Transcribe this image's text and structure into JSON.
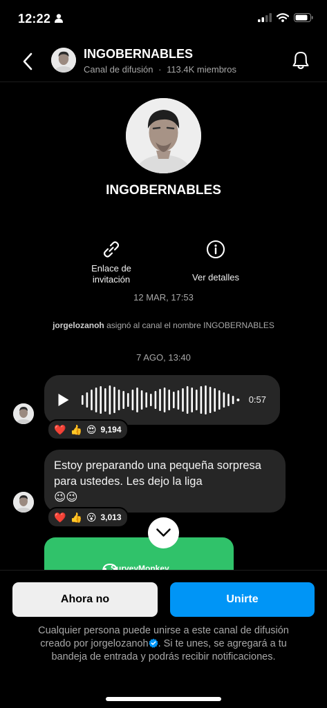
{
  "status": {
    "time": "12:22"
  },
  "header": {
    "title": "INGOBERNABLES",
    "subtitle_kind": "Canal de difusión",
    "separator": "·",
    "members": "113.4K miembros"
  },
  "profile": {
    "name": "INGOBERNABLES"
  },
  "actions": {
    "invite_line1": "Enlace de",
    "invite_line2": "invitación",
    "details": "Ver detalles"
  },
  "timeline": {
    "date1": "12 MAR, 17:53",
    "system_user": "jorgelozanoh",
    "system_text": " asignó al canal el nombre INGOBERNABLES",
    "date2": "7 AGO, 13:40"
  },
  "voice_message": {
    "duration": "0:57",
    "reactions": {
      "emojis": [
        "❤️",
        "👍",
        "😍"
      ],
      "count": "9,194"
    }
  },
  "text_message": {
    "text": "Estoy preparando una pequeña sorpresa para ustedes. Les dejo la liga",
    "emoji_line": "😉😉",
    "reactions": {
      "emojis": [
        "❤️",
        "👍",
        "😮"
      ],
      "count": "3,013"
    }
  },
  "link_preview": {
    "brand": "SurveyMonkey"
  },
  "bottom": {
    "decline": "Ahora no",
    "join": "Unirte",
    "disclaimer_line1": "Cualquier persona puede unirse a este canal de difusión",
    "disclaimer_pre": "creado por jorgelozanoh",
    "disclaimer_post": ". Si te unes, se agregará a tu",
    "disclaimer_line3": "bandeja de entrada y podrás recibir notificaciones."
  },
  "colors": {
    "accent": "#0095f6",
    "bubble": "#262626",
    "card": "#30c26a"
  },
  "icons": [
    "person-icon",
    "signal-icon",
    "wifi-icon",
    "battery-icon",
    "back-icon",
    "bell-icon",
    "link-icon",
    "info-icon",
    "play-icon",
    "chevron-down-icon",
    "verified-icon"
  ]
}
